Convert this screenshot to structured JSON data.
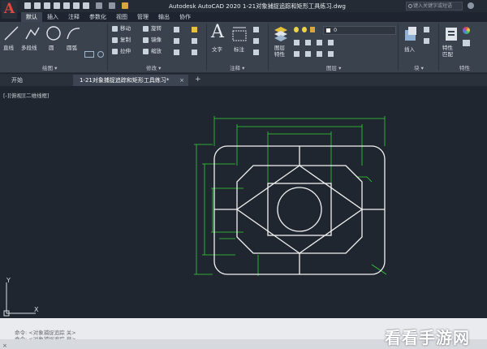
{
  "app": {
    "title": "Autodesk AutoCAD 2020    1-21对象捕捉追踪和矩形工具练习.dwg",
    "search_placeholder": "键入关键字或短语",
    "logo_letter": "A"
  },
  "ribbon_tabs": [
    "默认",
    "插入",
    "注释",
    "参数化",
    "视图",
    "管理",
    "输出",
    "协作"
  ],
  "ribbon": {
    "draw": {
      "line": "直线",
      "polyline": "多段线",
      "circle": "圆",
      "arc": "圆弧",
      "group_label": "绘图 ▾"
    },
    "modify": {
      "move": "移动",
      "rotate": "旋转",
      "copy": "复制",
      "mirror": "镜像",
      "stretch": "拉伸",
      "scale": "缩放",
      "group_label": "修改 ▾"
    },
    "annotation": {
      "text": "文字",
      "dimension": "标注",
      "group_label": "注释 ▾"
    },
    "layers": {
      "properties": "图层特性",
      "current_layer": "0",
      "group_label": "图层 ▾"
    },
    "block": {
      "insert": "插入",
      "group_label": "块 ▾"
    },
    "properties": {
      "match": "特性匹配",
      "label": "特性"
    }
  },
  "doc_tabs": {
    "start": "开始",
    "drawing": "1-21对象捕捉追踪和矩形工具练习*",
    "close": "×",
    "add": "+"
  },
  "viewport_label": "[-][俯视][二维线框]",
  "command": {
    "lines": [
      "命令:  <对象捕捉追踪 关>",
      "命令:  <对象捕捉追踪 开>"
    ],
    "close": "×"
  },
  "watermark": "看看手游网",
  "colors": {
    "geometry": "#f2f2f2",
    "dimension": "#2fd43a",
    "background": "#20262f"
  }
}
